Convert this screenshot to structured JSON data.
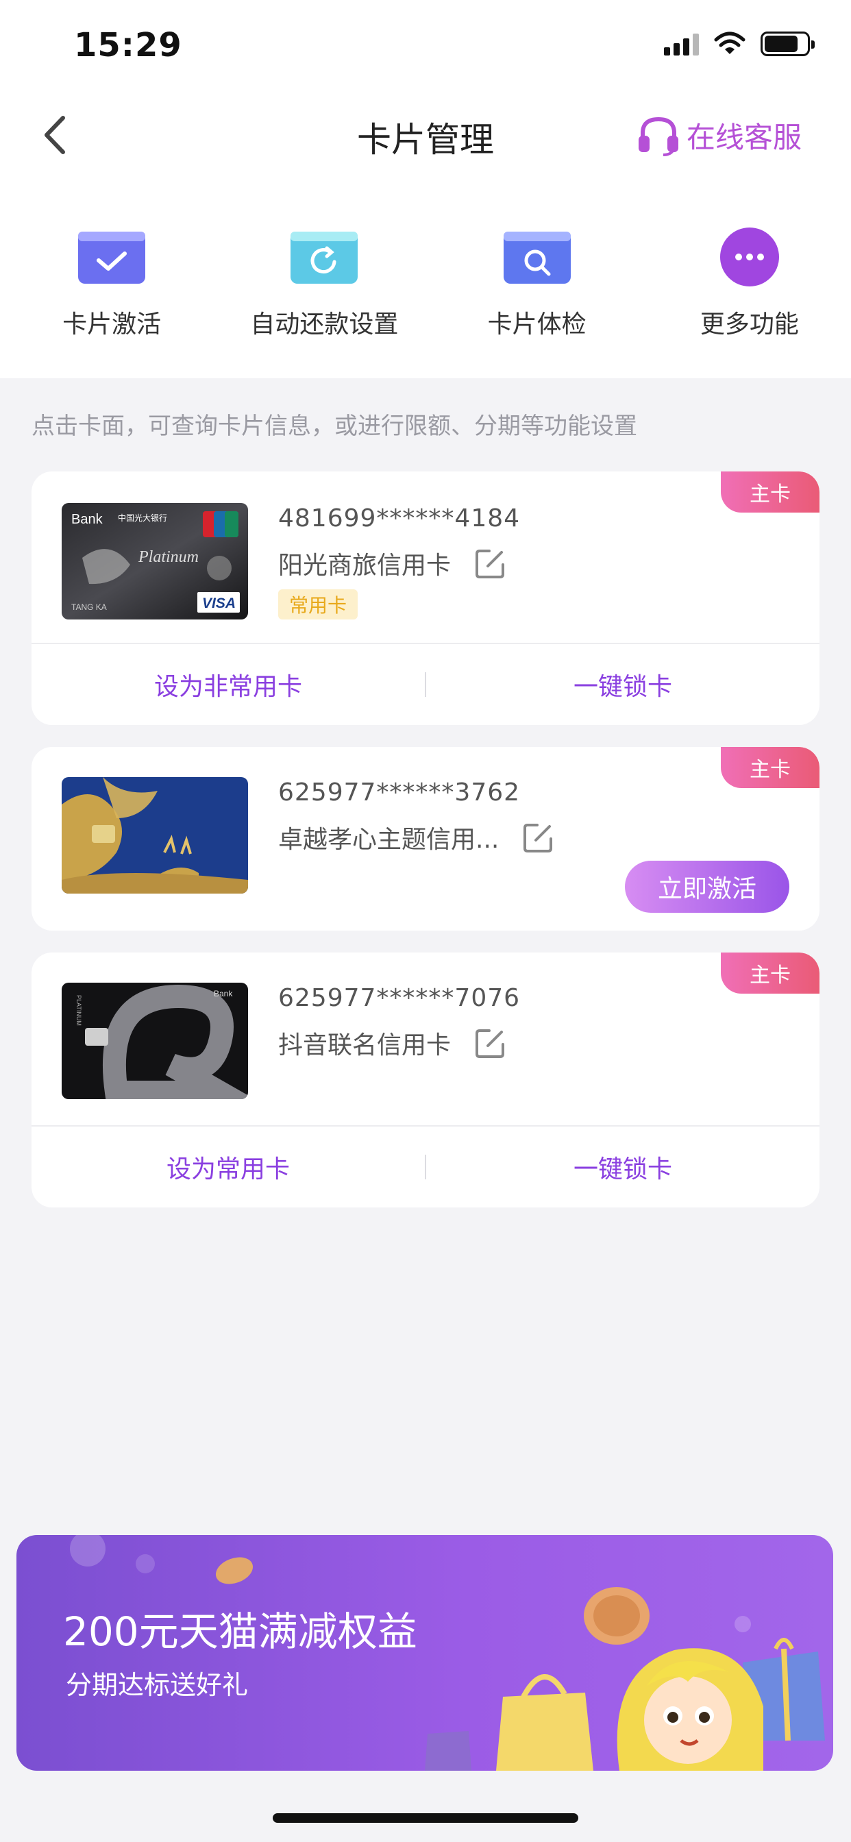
{
  "status_bar": {
    "time": "15:29"
  },
  "nav": {
    "title": "卡片管理",
    "service_label": "在线客服"
  },
  "functions": [
    {
      "label": "卡片激活",
      "icon": "card-activate-icon"
    },
    {
      "label": "自动还款设置",
      "icon": "auto-repay-icon"
    },
    {
      "label": "卡片体检",
      "icon": "card-check-icon"
    },
    {
      "label": "更多功能",
      "icon": "more-icon"
    }
  ],
  "hint": "点击卡面，可查询卡片信息，或进行限额、分期等功能设置",
  "cards": [
    {
      "badge": "主卡",
      "number": "481699******4184",
      "name": "阳光商旅信用卡",
      "tag": "常用卡",
      "action_left": "设为非常用卡",
      "action_right": "一键锁卡",
      "image_text": {
        "bank": "Bank",
        "bank_cn": "中国光大银行",
        "series": "Platinum",
        "holder": "TANG KA",
        "network": "VISA"
      }
    },
    {
      "badge": "主卡",
      "number": "625977******3762",
      "name": "卓越孝心主题信用...",
      "activate_label": "立即激活"
    },
    {
      "badge": "主卡",
      "number": "625977******7076",
      "name": "抖音联名信用卡",
      "action_left": "设为常用卡",
      "action_right": "一键锁卡",
      "image_text": {
        "series": "PLATINUM",
        "bank": "Bank"
      }
    }
  ],
  "banner": {
    "title": "200元天猫满减权益",
    "subtitle": "分期达标送好礼"
  },
  "colors": {
    "accent": "#8a3fe0",
    "service": "#b550d6",
    "badge": "#ea5b76",
    "tag_bg": "#fdf0cc",
    "tag_text": "#e8a91b",
    "background": "#f3f3f6"
  }
}
